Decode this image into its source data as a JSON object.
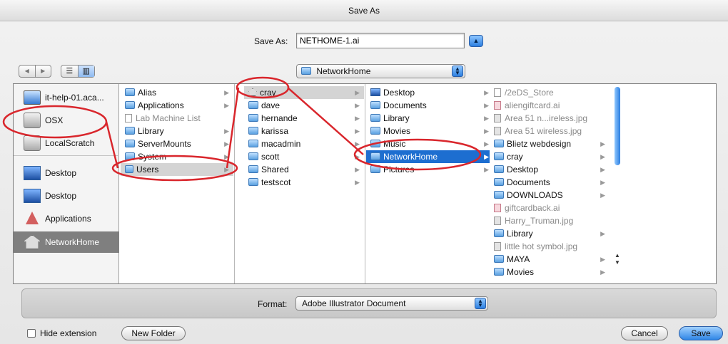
{
  "window": {
    "title": "Save As"
  },
  "save_as": {
    "label": "Save As:",
    "value": "NETHOME-1.ai"
  },
  "location": {
    "selected": "NetworkHome"
  },
  "sidebar": {
    "items": [
      {
        "label": "it-help-01.aca...",
        "icon": "computer-icon"
      },
      {
        "label": "OSX",
        "icon": "hard-disk-icon"
      },
      {
        "label": "LocalScratch",
        "icon": "hard-disk-icon"
      },
      {
        "label": "Desktop",
        "icon": "desktop-folder-icon"
      },
      {
        "label": "Desktop",
        "icon": "desktop-folder-icon"
      },
      {
        "label": "Applications",
        "icon": "applications-icon"
      },
      {
        "label": "NetworkHome",
        "icon": "home-icon"
      }
    ]
  },
  "columns": [
    {
      "items": [
        {
          "label": "Alias",
          "type": "folder"
        },
        {
          "label": "Applications",
          "type": "folder"
        },
        {
          "label": "Lab Machine List",
          "type": "document"
        },
        {
          "label": "Library",
          "type": "folder"
        },
        {
          "label": "ServerMounts",
          "type": "folder"
        },
        {
          "label": "System",
          "type": "folder"
        },
        {
          "label": "Users",
          "type": "folder"
        }
      ]
    },
    {
      "items": [
        {
          "label": "cray",
          "type": "home"
        },
        {
          "label": "dave",
          "type": "folder"
        },
        {
          "label": "hernande",
          "type": "folder"
        },
        {
          "label": "karissa",
          "type": "folder"
        },
        {
          "label": "macadmin",
          "type": "folder"
        },
        {
          "label": "scott",
          "type": "folder"
        },
        {
          "label": "Shared",
          "type": "folder"
        },
        {
          "label": "testscot",
          "type": "folder"
        }
      ]
    },
    {
      "items": [
        {
          "label": "Desktop",
          "type": "folder"
        },
        {
          "label": "Documents",
          "type": "folder"
        },
        {
          "label": "Library",
          "type": "folder"
        },
        {
          "label": "Movies",
          "type": "folder"
        },
        {
          "label": "Music",
          "type": "folder"
        },
        {
          "label": "NetworkHome",
          "type": "folder"
        },
        {
          "label": "Pictures",
          "type": "folder"
        }
      ]
    },
    {
      "items": [
        {
          "label": "/2eDS_Store",
          "type": "document"
        },
        {
          "label": "aliengiftcard.ai",
          "type": "ai"
        },
        {
          "label": "Area 51 n...ireless.jpg",
          "type": "image"
        },
        {
          "label": "Area 51 wireless.jpg",
          "type": "image"
        },
        {
          "label": "Blietz webdesign",
          "type": "folder"
        },
        {
          "label": "cray",
          "type": "folder"
        },
        {
          "label": "Desktop",
          "type": "folder"
        },
        {
          "label": "Documents",
          "type": "folder"
        },
        {
          "label": "DOWNLOADS",
          "type": "folder"
        },
        {
          "label": "giftcardback.ai",
          "type": "ai"
        },
        {
          "label": "Harry_Truman.jpg",
          "type": "image"
        },
        {
          "label": "Library",
          "type": "folder"
        },
        {
          "label": "little hot symbol.jpg",
          "type": "image"
        },
        {
          "label": "MAYA",
          "type": "folder"
        },
        {
          "label": "Movies",
          "type": "folder"
        }
      ]
    }
  ],
  "format": {
    "label": "Format:",
    "selected": "Adobe Illustrator Document"
  },
  "bottom": {
    "hide_extension_label": "Hide extension",
    "new_folder_label": "New Folder",
    "cancel_label": "Cancel",
    "save_label": "Save"
  },
  "colors": {
    "selection_blue": "#1d6ed0",
    "annotation_red": "#d9262c",
    "accent_blue": "#2c7fe0"
  }
}
